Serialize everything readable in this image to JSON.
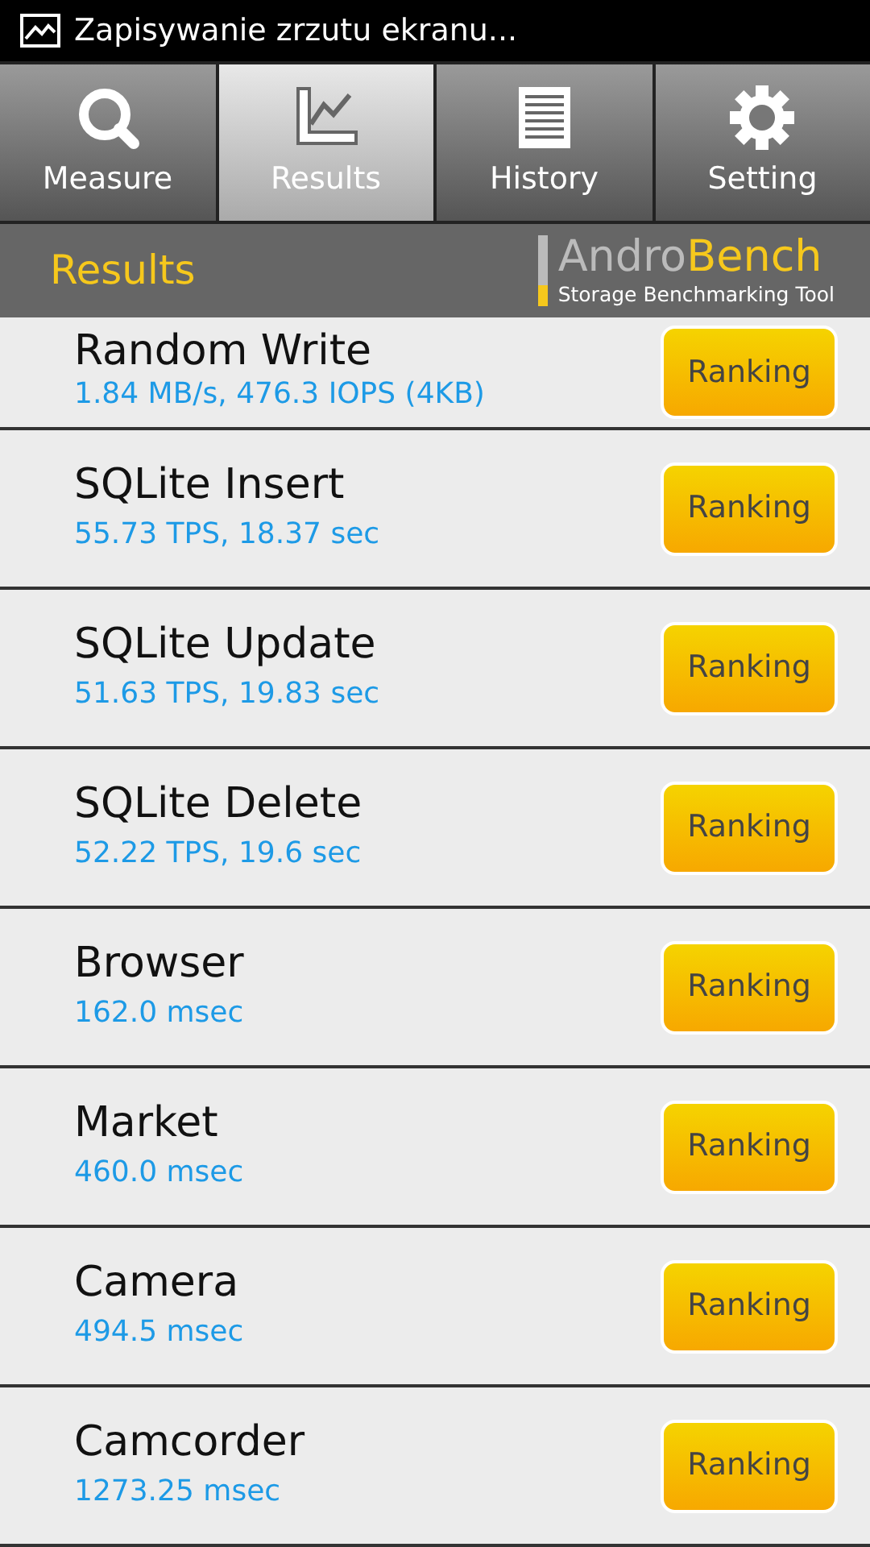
{
  "status_bar": {
    "notification": "Zapisywanie zrzutu ekranu..."
  },
  "tabs": [
    {
      "label": "Measure",
      "kind": "search",
      "selected": false
    },
    {
      "label": "Results",
      "kind": "chart",
      "selected": true
    },
    {
      "label": "History",
      "kind": "list",
      "selected": false
    },
    {
      "label": "Setting",
      "kind": "gear",
      "selected": false
    }
  ],
  "header": {
    "title": "Results",
    "logo_part_1": "Andro",
    "logo_part_2": "Bench",
    "logo_tagline": "Storage Benchmarking Tool"
  },
  "results": [
    {
      "name": "Random Write",
      "value": "1.84 MB/s, 476.3 IOPS (4KB)",
      "button": "Ranking"
    },
    {
      "name": "SQLite Insert",
      "value": "55.73 TPS, 18.37 sec",
      "button": "Ranking"
    },
    {
      "name": "SQLite Update",
      "value": "51.63 TPS, 19.83 sec",
      "button": "Ranking"
    },
    {
      "name": "SQLite Delete",
      "value": "52.22 TPS, 19.6 sec",
      "button": "Ranking"
    },
    {
      "name": "Browser",
      "value": "162.0 msec",
      "button": "Ranking"
    },
    {
      "name": "Market",
      "value": "460.0 msec",
      "button": "Ranking"
    },
    {
      "name": "Camera",
      "value": "494.5 msec",
      "button": "Ranking"
    },
    {
      "name": "Camcorder",
      "value": "1273.25 msec",
      "button": "Ranking"
    }
  ]
}
